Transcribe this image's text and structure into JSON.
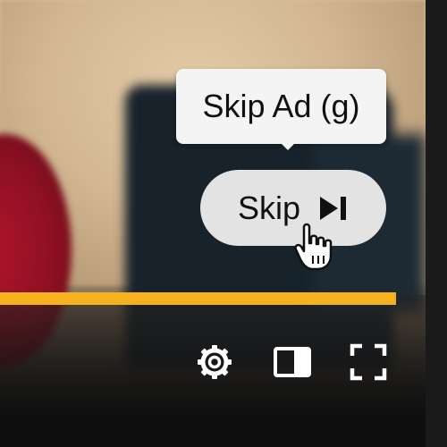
{
  "ad": {
    "tooltip_text": "Skip Ad (g)",
    "skip_label": "Skip",
    "skip_icon": "skip-next-icon"
  },
  "player": {
    "progress_fraction": 1.0,
    "progress_color": "#f6b11f",
    "controls": [
      {
        "name": "settings-gear-icon"
      },
      {
        "name": "theater-mode-icon"
      },
      {
        "name": "fullscreen-icon"
      }
    ]
  }
}
